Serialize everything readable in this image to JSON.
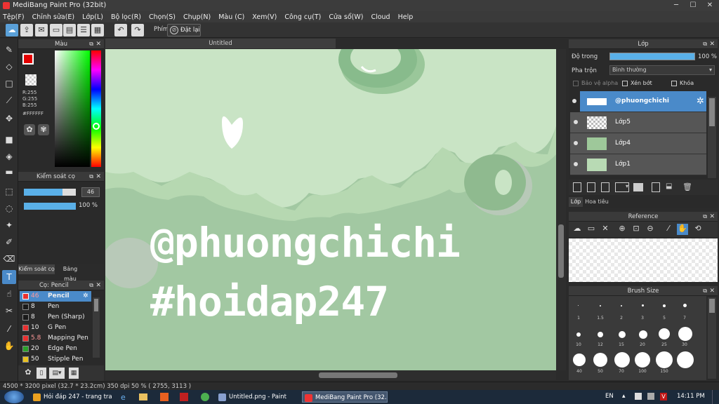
{
  "window": {
    "title": "MediBang Paint Pro (32bit)",
    "min": "─",
    "max": "☐",
    "close": "✕"
  },
  "menu": [
    "Tệp(F)",
    "Chỉnh sửa(E)",
    "Lớp(L)",
    "Bộ lọc(R)",
    "Chọn(S)",
    "Chụp(N)",
    "Màu (C)",
    "Xem(V)",
    "Công cụ(T)",
    "Cửa sổ(W)",
    "Cloud",
    "Help"
  ],
  "toolbar": {
    "phim_label": "Phím",
    "reset_label": "Đặt lại"
  },
  "color_panel": {
    "title": "Màu",
    "r": "R:255",
    "g": "G:255",
    "b": "B:255",
    "hex": "#FFFFFF",
    "fg": "#ff0000"
  },
  "brush_control": {
    "title": "Kiểm soát cọ",
    "size": "46",
    "opacity": "100 %",
    "tabs": [
      "Kiểm soát cọ",
      "Bảng màu"
    ]
  },
  "brush_panel": {
    "title": "Cọ: Pencil",
    "items": [
      {
        "size": "46",
        "name": "Pencil",
        "color": "#e83030"
      },
      {
        "size": "8",
        "name": "Pen",
        "color": "#1a1a1a"
      },
      {
        "size": "8",
        "name": "Pen (Sharp)",
        "color": "#1a1a1a"
      },
      {
        "size": "10",
        "name": "G Pen",
        "color": "#e83030"
      },
      {
        "size": "5.8",
        "name": "Mapping Pen",
        "color": "#e83030"
      },
      {
        "size": "20",
        "name": "Edge Pen",
        "color": "#2aa02a"
      },
      {
        "size": "50",
        "name": "Stipple Pen",
        "color": "#e8c020"
      }
    ]
  },
  "canvas": {
    "tab": "Untitled",
    "text_line1": "@phuongchichi",
    "text_line2": "#hoidap247",
    "bg": "#a2c8a2"
  },
  "layer_panel": {
    "title": "Lớp",
    "opacity_label": "Độ trong",
    "opacity_value": "100 %",
    "blend_label": "Pha trộn",
    "blend_value": "Bình thường",
    "protect_alpha": "Bảo vệ alpha",
    "clip": "Xén bớt",
    "lock": "Khóa",
    "layers": [
      {
        "name": "@phuongchichi"
      },
      {
        "name": "Lớp5"
      },
      {
        "name": "Lớp4"
      },
      {
        "name": "Lớp1"
      }
    ],
    "tabs": [
      "Lớp",
      "Hoa tiêu"
    ]
  },
  "reference_panel": {
    "title": "Reference"
  },
  "brush_size_panel": {
    "title": "Brush Size",
    "labels": [
      "1",
      "1.5",
      "2",
      "3",
      "5",
      "7",
      "10",
      "12",
      "15",
      "20",
      "25",
      "30",
      "40",
      "50",
      "70",
      "100",
      "150"
    ]
  },
  "status": {
    "text": "4500 * 3200 pixel  (32.7 * 23.2cm)  350 dpi  50 %  ( 2755, 3113 )"
  },
  "taskbar": {
    "tasks": [
      "Hỏi đáp 247 - trang tra ...",
      "Untitled.png - Paint",
      "MediBang Paint Pro (32..."
    ],
    "lang": "EN",
    "time": "14:11 PM"
  }
}
